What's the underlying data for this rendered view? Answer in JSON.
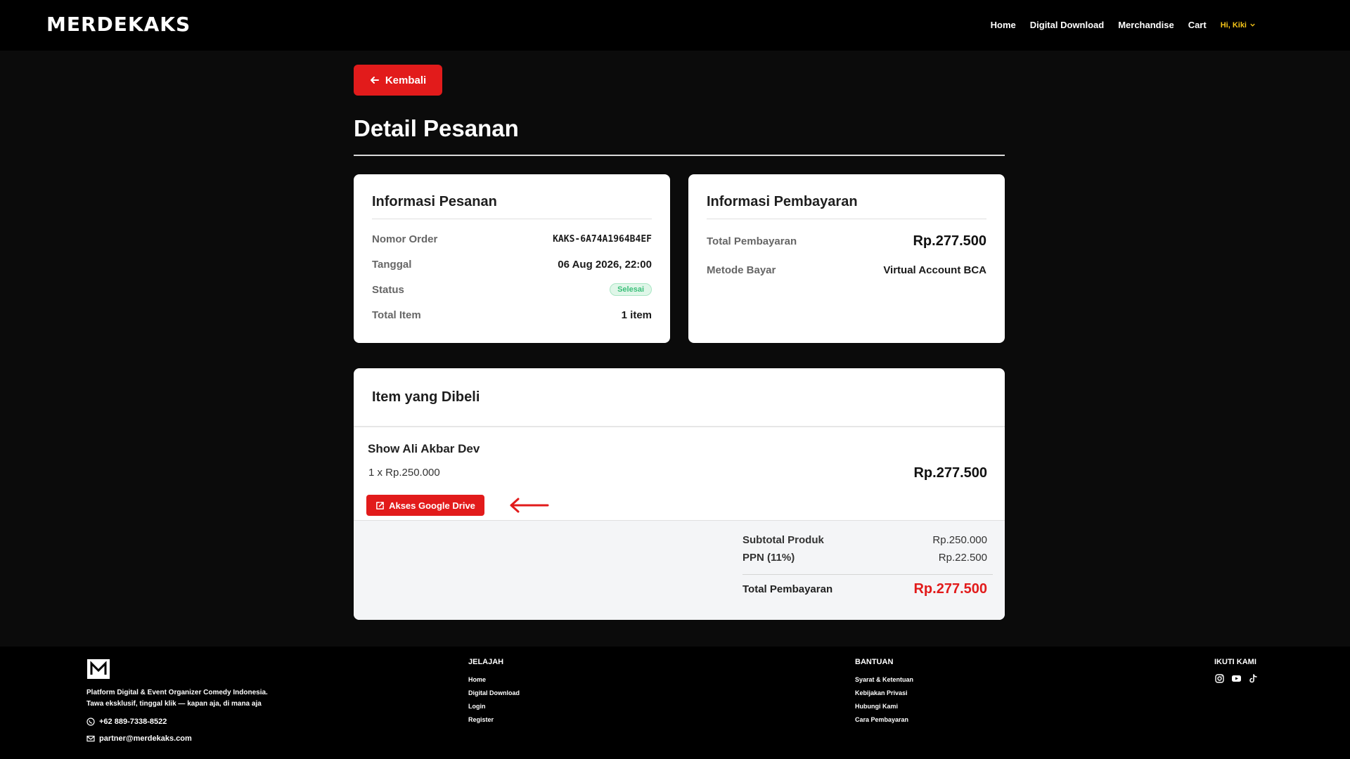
{
  "nav": {
    "logo": "MERDEKAKS",
    "links": [
      "Home",
      "Digital Download",
      "Merchandise",
      "Cart"
    ],
    "user": "Hi, Kiki"
  },
  "page": {
    "back_label": "Kembali",
    "title": "Detail Pesanan"
  },
  "order_info": {
    "heading": "Informasi Pesanan",
    "order_no_label": "Nomor Order",
    "order_no": "KAKS-6A74A1964B4EF",
    "date_label": "Tanggal",
    "date": "06 Aug 2026, 22:00",
    "status_label": "Status",
    "status": "Selesai",
    "total_item_label": "Total Item",
    "total_item": "1 item"
  },
  "payment_info": {
    "heading": "Informasi Pembayaran",
    "total_label": "Total Pembayaran",
    "total": "Rp.277.500",
    "method_label": "Metode Bayar",
    "method": "Virtual Account BCA"
  },
  "items": {
    "heading": "Item yang Dibeli",
    "product_name": "Show Ali Akbar Dev",
    "product_qty": "1 x Rp.250.000",
    "product_price": "Rp.277.500",
    "drive_button": "Akses Google Drive"
  },
  "summary": {
    "subtotal_label": "Subtotal Produk",
    "subtotal": "Rp.250.000",
    "ppn_label": "PPN (11%)",
    "ppn": "Rp.22.500",
    "total_label": "Total Pembayaran",
    "total": "Rp.277.500"
  },
  "footer": {
    "tagline_1": "Platform Digital & Event Organizer Comedy Indonesia.",
    "tagline_2": "Tawa eksklusif, tinggal klik — kapan aja, di mana aja",
    "phone": "+62 889-7338-8522",
    "email": "partner@merdekaks.com",
    "jelajah_title": "JELAJAH",
    "jelajah": [
      "Home",
      "Digital Download",
      "Login",
      "Register"
    ],
    "bantuan_title": "BANTUAN",
    "bantuan": [
      "Syarat & Ketentuan",
      "Kebijakan Privasi",
      "Hubungi Kami",
      "Cara Pembayaran"
    ],
    "social_title": "IKUTI KAMI"
  },
  "colors": {
    "accent": "#e21b1b",
    "user_highlight": "#f5c518",
    "status_green": "#3bbf7a"
  },
  "icons": [
    "arrow-left-icon",
    "chevron-down-icon",
    "external-link-icon",
    "whatsapp-icon",
    "mail-icon",
    "instagram-icon",
    "youtube-icon",
    "tiktok-icon"
  ]
}
